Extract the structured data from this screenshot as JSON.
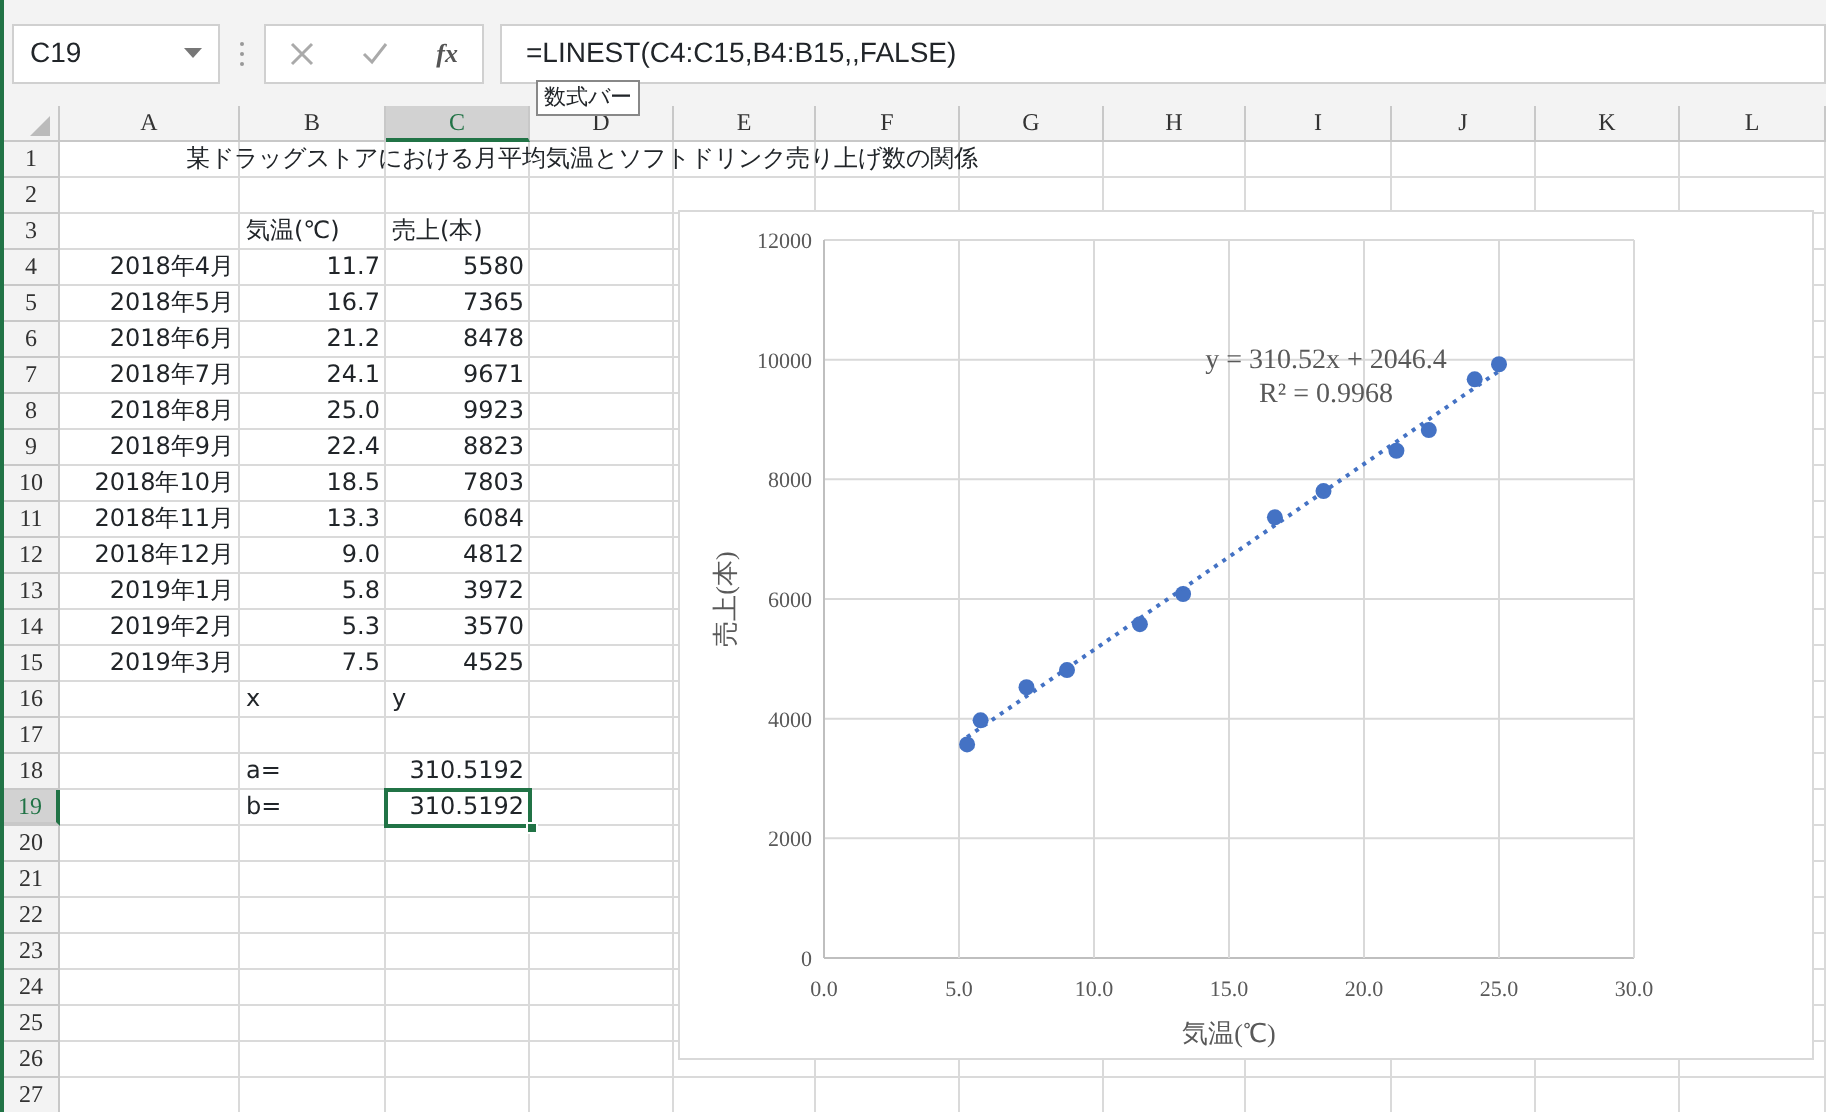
{
  "formula_bar": {
    "name_box": "C19",
    "function_button": "fx",
    "formula": "=LINEST(C4:C15,B4:B15,,FALSE)",
    "tooltip": "数式バー"
  },
  "sheet": {
    "columns": [
      {
        "label": "A",
        "selected": false
      },
      {
        "label": "B",
        "selected": false
      },
      {
        "label": "C",
        "selected": true
      },
      {
        "label": "D",
        "selected": false
      },
      {
        "label": "E",
        "selected": false
      },
      {
        "label": "F",
        "selected": false
      },
      {
        "label": "G",
        "selected": false
      },
      {
        "label": "H",
        "selected": false
      },
      {
        "label": "I",
        "selected": false
      },
      {
        "label": "J",
        "selected": false
      },
      {
        "label": "K",
        "selected": false
      },
      {
        "label": "L",
        "selected": false
      }
    ],
    "rows": [
      {
        "number": "1",
        "selected": false,
        "cells": [
          {
            "text": "某ドラッグストアにおける月平均気温とソフトドリンク売り上げ数の関係",
            "kind": "title"
          }
        ]
      },
      {
        "number": "2",
        "selected": false,
        "cells": []
      },
      {
        "number": "3",
        "selected": false,
        "cells": [
          null,
          {
            "text": "気温(℃)",
            "kind": "text"
          },
          {
            "text": "売上(本)",
            "kind": "text"
          }
        ]
      },
      {
        "number": "4",
        "selected": false,
        "cells": [
          {
            "text": "2018年4月",
            "kind": "number"
          },
          {
            "text": "11.7",
            "kind": "number"
          },
          {
            "text": "5580",
            "kind": "number"
          }
        ]
      },
      {
        "number": "5",
        "selected": false,
        "cells": [
          {
            "text": "2018年5月",
            "kind": "number"
          },
          {
            "text": "16.7",
            "kind": "number"
          },
          {
            "text": "7365",
            "kind": "number"
          }
        ]
      },
      {
        "number": "6",
        "selected": false,
        "cells": [
          {
            "text": "2018年6月",
            "kind": "number"
          },
          {
            "text": "21.2",
            "kind": "number"
          },
          {
            "text": "8478",
            "kind": "number"
          }
        ]
      },
      {
        "number": "7",
        "selected": false,
        "cells": [
          {
            "text": "2018年7月",
            "kind": "number"
          },
          {
            "text": "24.1",
            "kind": "number"
          },
          {
            "text": "9671",
            "kind": "number"
          }
        ]
      },
      {
        "number": "8",
        "selected": false,
        "cells": [
          {
            "text": "2018年8月",
            "kind": "number"
          },
          {
            "text": "25.0",
            "kind": "number"
          },
          {
            "text": "9923",
            "kind": "number"
          }
        ]
      },
      {
        "number": "9",
        "selected": false,
        "cells": [
          {
            "text": "2018年9月",
            "kind": "number"
          },
          {
            "text": "22.4",
            "kind": "number"
          },
          {
            "text": "8823",
            "kind": "number"
          }
        ]
      },
      {
        "number": "10",
        "selected": false,
        "cells": [
          {
            "text": "2018年10月",
            "kind": "number"
          },
          {
            "text": "18.5",
            "kind": "number"
          },
          {
            "text": "7803",
            "kind": "number"
          }
        ]
      },
      {
        "number": "11",
        "selected": false,
        "cells": [
          {
            "text": "2018年11月",
            "kind": "number"
          },
          {
            "text": "13.3",
            "kind": "number"
          },
          {
            "text": "6084",
            "kind": "number"
          }
        ]
      },
      {
        "number": "12",
        "selected": false,
        "cells": [
          {
            "text": "2018年12月",
            "kind": "number"
          },
          {
            "text": "9.0",
            "kind": "number"
          },
          {
            "text": "4812",
            "kind": "number"
          }
        ]
      },
      {
        "number": "13",
        "selected": false,
        "cells": [
          {
            "text": "2019年1月",
            "kind": "number"
          },
          {
            "text": "5.8",
            "kind": "number"
          },
          {
            "text": "3972",
            "kind": "number"
          }
        ]
      },
      {
        "number": "14",
        "selected": false,
        "cells": [
          {
            "text": "2019年2月",
            "kind": "number"
          },
          {
            "text": "5.3",
            "kind": "number"
          },
          {
            "text": "3570",
            "kind": "number"
          }
        ]
      },
      {
        "number": "15",
        "selected": false,
        "cells": [
          {
            "text": "2019年3月",
            "kind": "number"
          },
          {
            "text": "7.5",
            "kind": "number"
          },
          {
            "text": "4525",
            "kind": "number"
          }
        ]
      },
      {
        "number": "16",
        "selected": false,
        "cells": [
          null,
          {
            "text": "x",
            "kind": "text"
          },
          {
            "text": "y",
            "kind": "text"
          }
        ]
      },
      {
        "number": "17",
        "selected": false,
        "cells": []
      },
      {
        "number": "18",
        "selected": false,
        "cells": [
          null,
          {
            "text": "a=",
            "kind": "text"
          },
          {
            "text": "310.5192",
            "kind": "number"
          }
        ]
      },
      {
        "number": "19",
        "selected": true,
        "cells": [
          null,
          {
            "text": "b=",
            "kind": "text"
          },
          {
            "text": "310.5192",
            "kind": "number",
            "selected": true
          }
        ]
      },
      {
        "number": "20",
        "selected": false,
        "cells": []
      },
      {
        "number": "21",
        "selected": false,
        "cells": []
      },
      {
        "number": "22",
        "selected": false,
        "cells": []
      },
      {
        "number": "23",
        "selected": false,
        "cells": []
      },
      {
        "number": "24",
        "selected": false,
        "cells": []
      },
      {
        "number": "25",
        "selected": false,
        "cells": []
      },
      {
        "number": "26",
        "selected": false,
        "cells": []
      },
      {
        "number": "27",
        "selected": false,
        "cells": []
      }
    ]
  },
  "chart": {
    "chart_data": {
      "type": "scatter",
      "xlabel": "気温(℃)",
      "ylabel": "売上(本)",
      "series": [
        {
          "color": "#4472c4",
          "x": [
            11.7,
            16.7,
            21.2,
            24.1,
            25.0,
            22.4,
            18.5,
            13.3,
            9.0,
            5.8,
            5.3,
            7.5
          ],
          "values": [
            5580,
            7365,
            8478,
            9671,
            9923,
            8823,
            7803,
            6084,
            4812,
            3972,
            3570,
            4525
          ]
        },
        {
          "type": "line",
          "line_style": "dotted",
          "color": "#4472c4",
          "x": [
            5.3,
            25.0
          ],
          "values": [
            3692,
            9809
          ]
        }
      ],
      "xlim": [
        0,
        30
      ],
      "ylim": [
        0,
        12000
      ],
      "xticks": [
        {
          "value": 0,
          "label": "0.0"
        },
        {
          "value": 5,
          "label": "5.0"
        },
        {
          "value": 10,
          "label": "10.0"
        },
        {
          "value": 15,
          "label": "15.0"
        },
        {
          "value": 20,
          "label": "20.0"
        },
        {
          "value": 25,
          "label": "25.0"
        },
        {
          "value": 30,
          "label": "30.0"
        }
      ],
      "yticks": [
        0,
        2000,
        4000,
        6000,
        8000,
        10000,
        12000
      ],
      "grid": true,
      "annotations": [
        "y = 310.52x + 2046.4",
        "R² = 0.9968"
      ]
    }
  }
}
